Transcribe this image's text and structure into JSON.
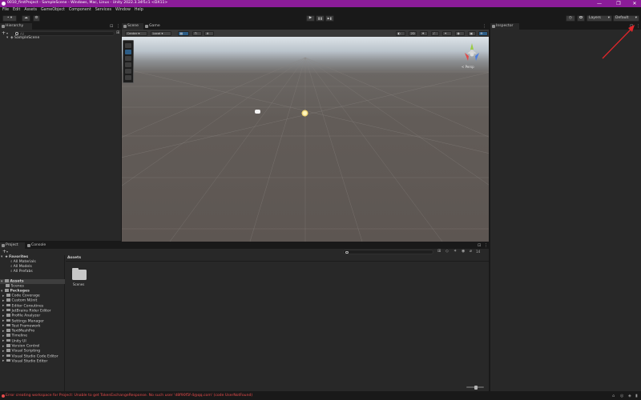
{
  "window": {
    "title": "0010_firstProject - SampleScene - Windows, Mac, Linux - Unity 2022.3.34f1c1 <DX11>",
    "minimize": "—",
    "maximize": "❐",
    "close": "✕"
  },
  "menu": [
    "File",
    "Edit",
    "Assets",
    "GameObject",
    "Component",
    "Services",
    "Window",
    "Help"
  ],
  "toolbar": {
    "account": "•",
    "play": "▶",
    "pause": "❚❚",
    "step": "▶❚",
    "layers_label": "Layers",
    "layout_label": "Default"
  },
  "hierarchy": {
    "tab": "Hierarchy",
    "search_placeholder": "All",
    "items": [
      {
        "label": "SampleScene"
      }
    ]
  },
  "scene": {
    "tabs": [
      "Scene",
      "Game"
    ],
    "pivot_label": "Center",
    "space_label": "Local",
    "gizmo_label": "< Persp",
    "gizmo_y": "y",
    "gizmo_x": "x",
    "gizmo_z": "z"
  },
  "inspector": {
    "tab": "Inspector"
  },
  "project": {
    "tabs": [
      "Project",
      "Console"
    ],
    "count": "14",
    "breadcrumb": "Assets",
    "favorites": {
      "label": "Favorites",
      "items": [
        "All Materials",
        "All Models",
        "All Prefabs"
      ]
    },
    "assets_root": "Assets",
    "asset_children": [
      "Scenes"
    ],
    "packages_root": "Packages",
    "packages": [
      "Code Coverage",
      "Custom NUnit",
      "Editor Coroutines",
      "JetBrains Rider Editor",
      "Profile Analyzer",
      "Settings Manager",
      "Test Framework",
      "TextMeshPro",
      "Timeline",
      "Unity UI",
      "Version Control",
      "Visual Scripting",
      "Visual Studio Code Editor",
      "Visual Studio Editor"
    ],
    "grid_items": [
      "Scenes"
    ]
  },
  "status": {
    "message": "Error creating workspace for Project: Unable to get TokenExchangeResponse. No such user 'd8f90f5f-4@qq.com' (code UserNotFound)"
  },
  "colors": {
    "title_bar": "#8b1c98",
    "error_text": "#e84b4b",
    "annotation_arrow": "#e0262a",
    "selection": "#2c5d87"
  }
}
